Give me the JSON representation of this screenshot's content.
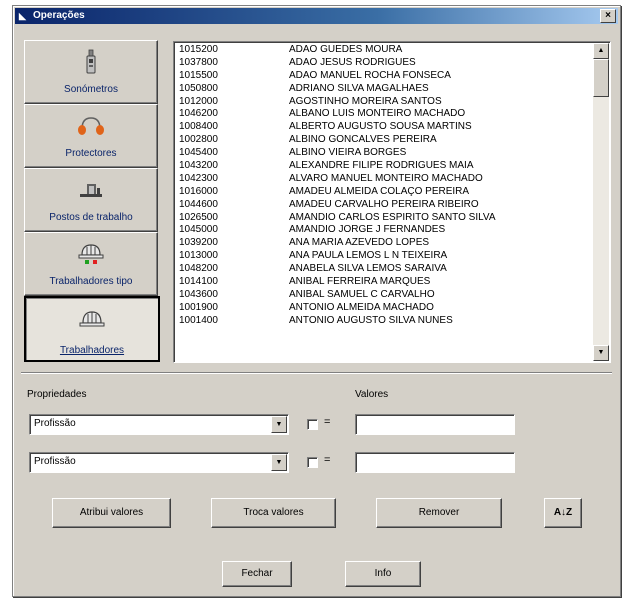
{
  "window": {
    "title": "Operações",
    "close_label": "×"
  },
  "nav": [
    {
      "label": "Sonómetros",
      "icon": "sonometer-icon"
    },
    {
      "label": "Protectores",
      "icon": "headphones-icon"
    },
    {
      "label": "Postos de trabalho",
      "icon": "workstation-icon"
    },
    {
      "label": "Trabalhadores tipo",
      "icon": "hardhat-icon"
    },
    {
      "label": "Trabalhadores",
      "icon": "hardhat-icon"
    }
  ],
  "workers": [
    {
      "code": "1015200",
      "name": "ADAO GUEDES MOURA"
    },
    {
      "code": "1037800",
      "name": "ADAO JESUS RODRIGUES"
    },
    {
      "code": "1015500",
      "name": "ADAO MANUEL ROCHA FONSECA"
    },
    {
      "code": "1050800",
      "name": "ADRIANO SILVA MAGALHAES"
    },
    {
      "code": "1012000",
      "name": "AGOSTINHO MOREIRA SANTOS"
    },
    {
      "code": "1046200",
      "name": "ALBANO LUIS MONTEIRO MACHADO"
    },
    {
      "code": "1008400",
      "name": "ALBERTO AUGUSTO SOUSA MARTINS"
    },
    {
      "code": "1002800",
      "name": "ALBINO GONCALVES PEREIRA"
    },
    {
      "code": "1045400",
      "name": "ALBINO VIEIRA BORGES"
    },
    {
      "code": "1043200",
      "name": "ALEXANDRE FILIPE RODRIGUES MAIA"
    },
    {
      "code": "1042300",
      "name": "ALVARO MANUEL MONTEIRO MACHADO"
    },
    {
      "code": "1016000",
      "name": "AMADEU ALMEIDA COLAÇO  PEREIRA"
    },
    {
      "code": "1044600",
      "name": "AMADEU CARVALHO PEREIRA RIBEIRO"
    },
    {
      "code": "1026500",
      "name": "AMANDIO CARLOS ESPIRITO SANTO SILVA"
    },
    {
      "code": "1045000",
      "name": "AMANDIO JORGE J FERNANDES"
    },
    {
      "code": "1039200",
      "name": "ANA MARIA AZEVEDO LOPES"
    },
    {
      "code": "1013000",
      "name": "ANA PAULA LEMOS L N TEIXEIRA"
    },
    {
      "code": "1048200",
      "name": "ANABELA SILVA LEMOS SARAIVA"
    },
    {
      "code": "1014100",
      "name": "ANIBAL FERREIRA MARQUES"
    },
    {
      "code": "1043600",
      "name": "ANIBAL SAMUEL C CARVALHO"
    },
    {
      "code": "1001900",
      "name": "ANTONIO ALMEIDA MACHADO"
    },
    {
      "code": "1001400",
      "name": "ANTONIO AUGUSTO SILVA NUNES"
    }
  ],
  "form": {
    "properties_label": "Propriedades",
    "values_label": "Valores",
    "property1": "Profissão",
    "property2": "Profissão",
    "equals": "=",
    "value1": "",
    "value2": ""
  },
  "buttons": {
    "assign": "Atribui valores",
    "swap": "Troca valores",
    "remove": "Remover",
    "sort": "A↓Z",
    "close": "Fechar",
    "info": "Info"
  }
}
